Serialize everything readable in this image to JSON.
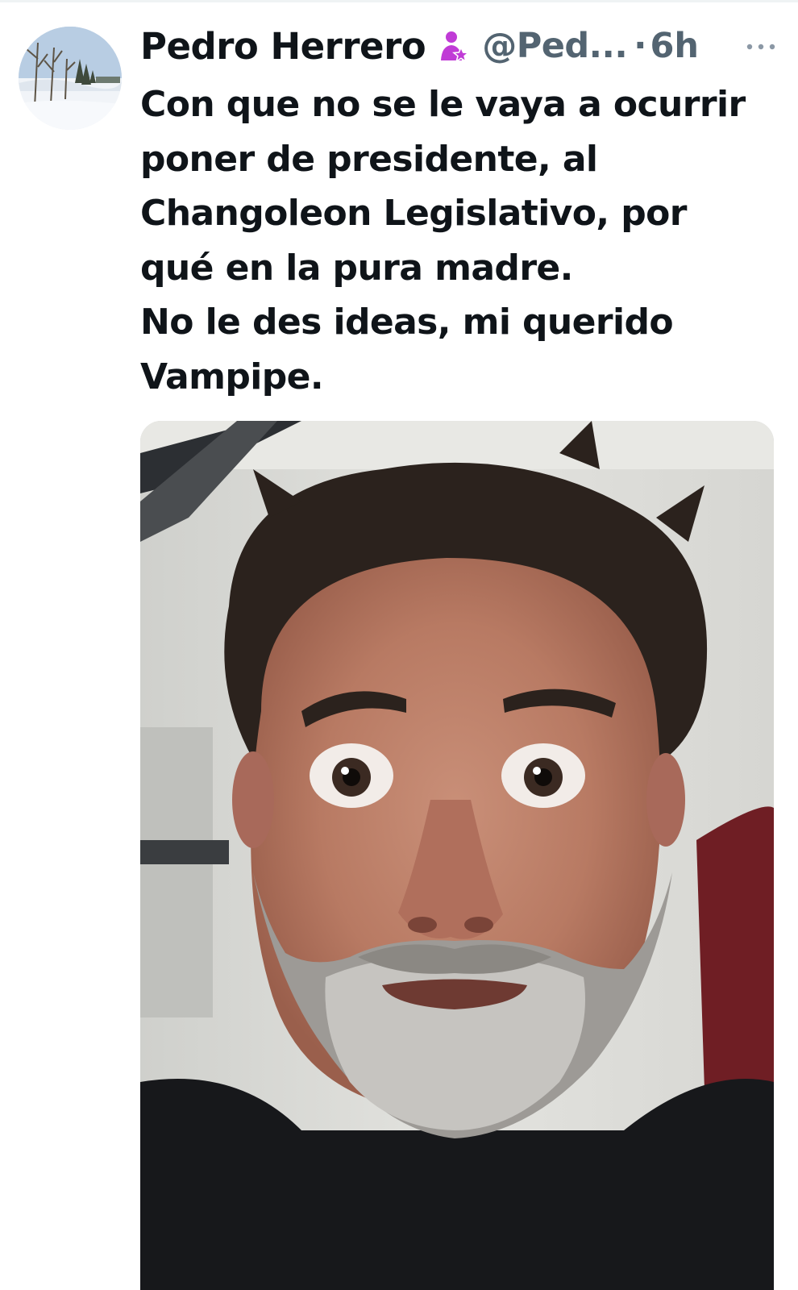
{
  "tweet": {
    "author": {
      "display_name": "Pedro Herrero",
      "badge_icon": "woman-fairy-emoji-icon",
      "handle": "@Ped...",
      "separator": "·",
      "time": "6h",
      "avatar": "snowy-landscape-avatar"
    },
    "more_icon": "more-horizontal-icon",
    "text_lines": [
      "Con que no se le vaya a ocurrir",
      "poner de presidente, al",
      "Changoleon Legislativo, por",
      "qué en la pura madre.",
      "No le des ideas, mi querido",
      "Vampipe."
    ],
    "media": {
      "type": "photo",
      "description_icon": "selfie-photo"
    }
  },
  "colors": {
    "text_primary": "#0f1419",
    "text_secondary": "#536471",
    "badge": "#c03bd6"
  }
}
